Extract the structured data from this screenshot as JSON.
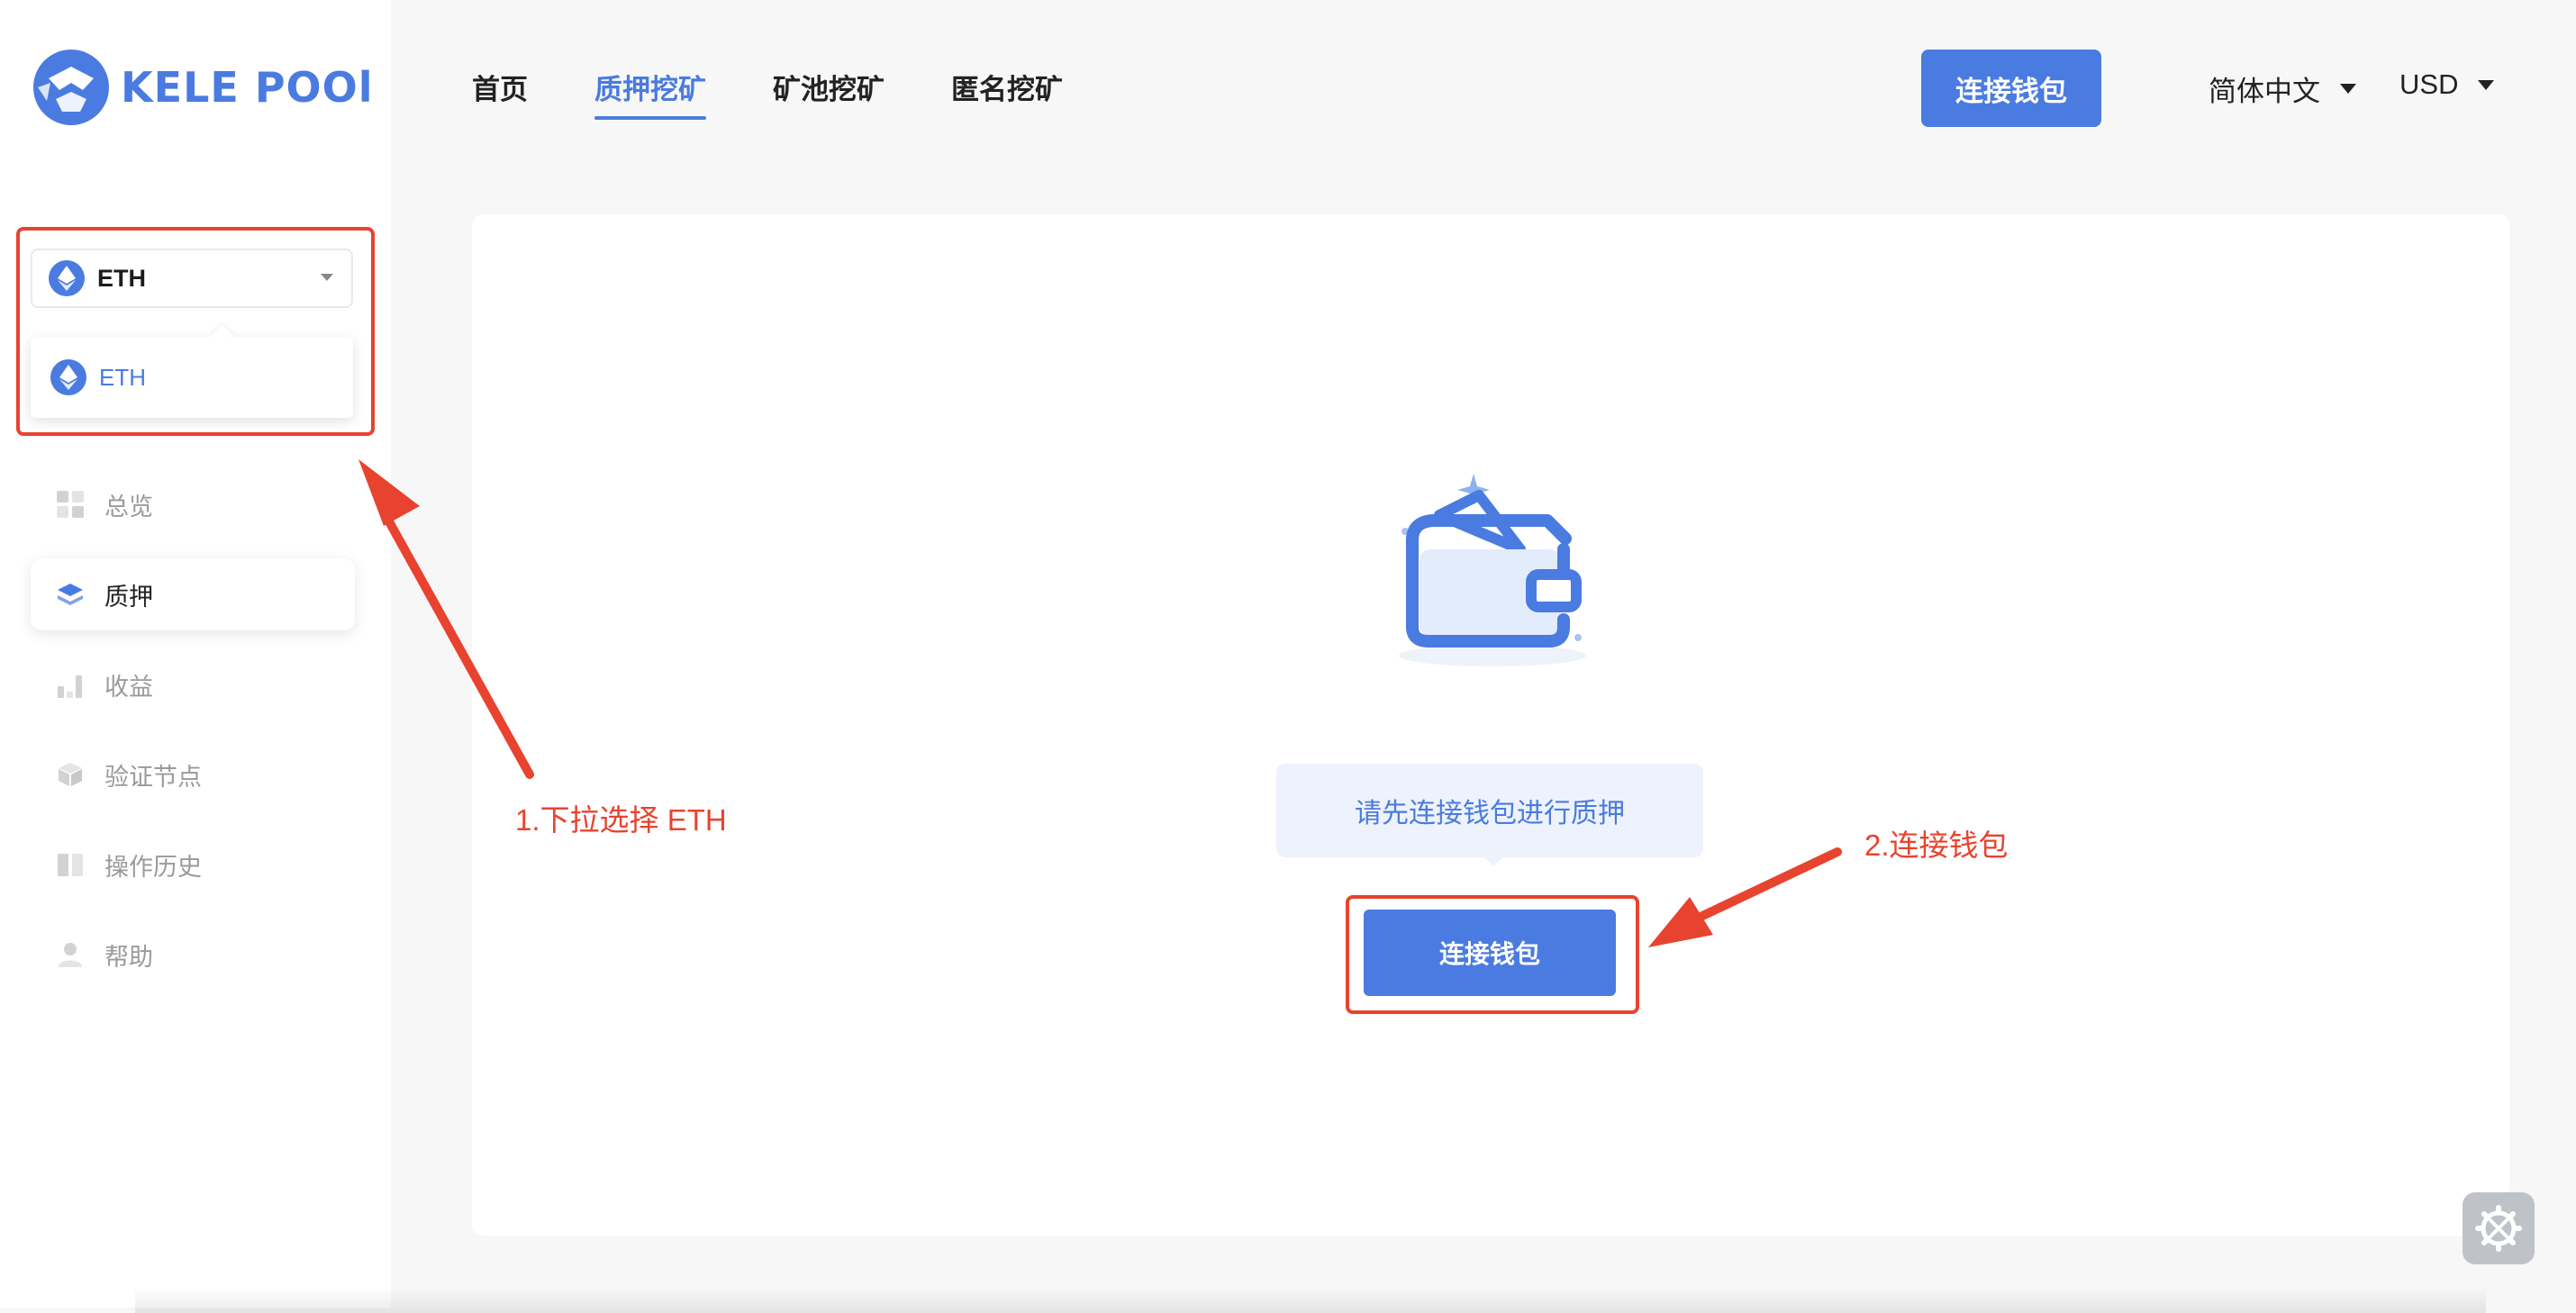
{
  "brand": {
    "logo_text": "KELE POOl",
    "accent": "#4a7be0",
    "annotation_color": "#e8432e"
  },
  "header": {
    "tabs": [
      {
        "label": "首页",
        "active": false
      },
      {
        "label": "质押挖矿",
        "active": true
      },
      {
        "label": "矿池挖矿",
        "active": false
      },
      {
        "label": "匿名挖矿",
        "active": false
      }
    ],
    "connect_label": "连接钱包",
    "language": "简体中文",
    "currency": "USD"
  },
  "sidebar": {
    "coin_select": {
      "selected": "ETH",
      "options": [
        "ETH"
      ],
      "icon": "ethereum-icon"
    },
    "items": [
      {
        "label": "总览",
        "icon": "grid-icon",
        "active": false
      },
      {
        "label": "质押",
        "icon": "layers-icon",
        "active": true
      },
      {
        "label": "收益",
        "icon": "bar-chart-icon",
        "active": false
      },
      {
        "label": "验证节点",
        "icon": "cube-icon",
        "active": false
      },
      {
        "label": "操作历史",
        "icon": "book-icon",
        "active": false
      },
      {
        "label": "帮助",
        "icon": "user-icon",
        "active": false
      }
    ]
  },
  "main": {
    "empty_icon": "wallet-icon",
    "prompt": "请先连接钱包进行质押",
    "connect_label": "连接钱包"
  },
  "annotations": {
    "step1": "1.下拉选择 ETH",
    "step2": "2.连接钱包"
  },
  "floating": {
    "icon": "settings-icon"
  }
}
